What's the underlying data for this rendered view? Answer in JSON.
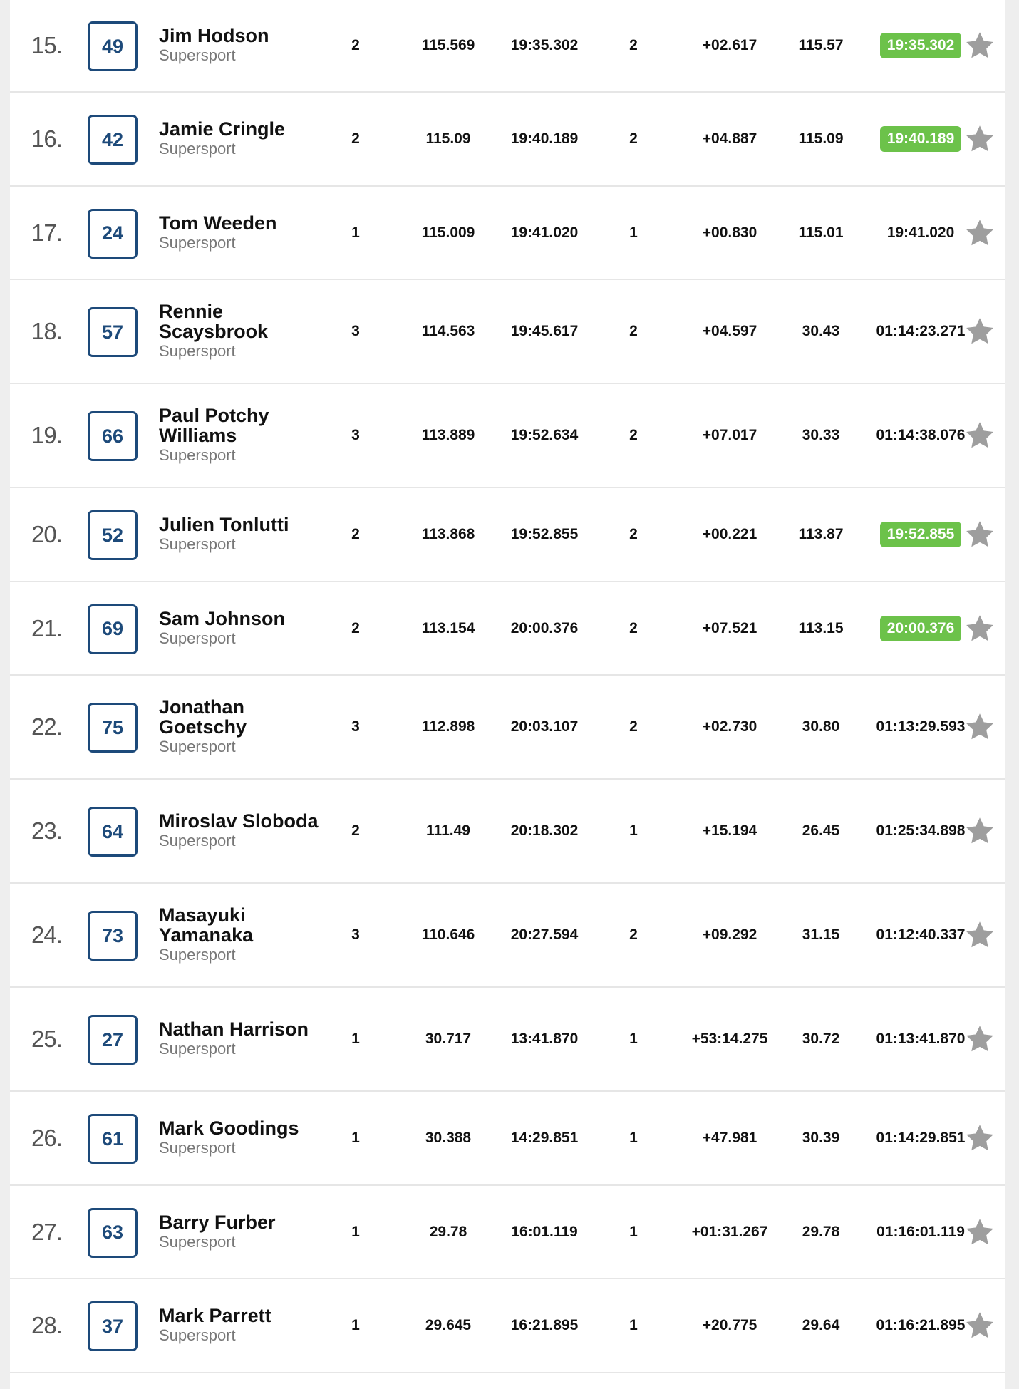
{
  "rows": [
    {
      "pos": "15.",
      "number": "49",
      "name": "Jim Hodson",
      "class": "Supersport",
      "laps": "2",
      "speed": "115.569",
      "time": "19:35.302",
      "best_lap": "2",
      "gap": "+02.617",
      "best_speed": "115.57",
      "best_time": "19:35.302",
      "highlight": true
    },
    {
      "pos": "16.",
      "number": "42",
      "name": "Jamie Cringle",
      "class": "Supersport",
      "laps": "2",
      "speed": "115.09",
      "time": "19:40.189",
      "best_lap": "2",
      "gap": "+04.887",
      "best_speed": "115.09",
      "best_time": "19:40.189",
      "highlight": true
    },
    {
      "pos": "17.",
      "number": "24",
      "name": "Tom Weeden",
      "class": "Supersport",
      "laps": "1",
      "speed": "115.009",
      "time": "19:41.020",
      "best_lap": "1",
      "gap": "+00.830",
      "best_speed": "115.01",
      "best_time": "19:41.020",
      "highlight": false
    },
    {
      "pos": "18.",
      "number": "57",
      "name": "Rennie Scaysbrook",
      "class": "Supersport",
      "laps": "3",
      "speed": "114.563",
      "time": "19:45.617",
      "best_lap": "2",
      "gap": "+04.597",
      "best_speed": "30.43",
      "best_time": "01:14:23.271",
      "highlight": false
    },
    {
      "pos": "19.",
      "number": "66",
      "name": "Paul Potchy Williams",
      "class": "Supersport",
      "laps": "3",
      "speed": "113.889",
      "time": "19:52.634",
      "best_lap": "2",
      "gap": "+07.017",
      "best_speed": "30.33",
      "best_time": "01:14:38.076",
      "highlight": false
    },
    {
      "pos": "20.",
      "number": "52",
      "name": "Julien Tonlutti",
      "class": "Supersport",
      "laps": "2",
      "speed": "113.868",
      "time": "19:52.855",
      "best_lap": "2",
      "gap": "+00.221",
      "best_speed": "113.87",
      "best_time": "19:52.855",
      "highlight": true
    },
    {
      "pos": "21.",
      "number": "69",
      "name": "Sam Johnson",
      "class": "Supersport",
      "laps": "2",
      "speed": "113.154",
      "time": "20:00.376",
      "best_lap": "2",
      "gap": "+07.521",
      "best_speed": "113.15",
      "best_time": "20:00.376",
      "highlight": true
    },
    {
      "pos": "22.",
      "number": "75",
      "name": "Jonathan Goetschy",
      "class": "Supersport",
      "laps": "3",
      "speed": "112.898",
      "time": "20:03.107",
      "best_lap": "2",
      "gap": "+02.730",
      "best_speed": "30.80",
      "best_time": "01:13:29.593",
      "highlight": false
    },
    {
      "pos": "23.",
      "number": "64",
      "name": "Miroslav Sloboda",
      "class": "Supersport",
      "laps": "2",
      "speed": "111.49",
      "time": "20:18.302",
      "best_lap": "1",
      "gap": "+15.194",
      "best_speed": "26.45",
      "best_time": "01:25:34.898",
      "highlight": false
    },
    {
      "pos": "24.",
      "number": "73",
      "name": "Masayuki Yamanaka",
      "class": "Supersport",
      "laps": "3",
      "speed": "110.646",
      "time": "20:27.594",
      "best_lap": "2",
      "gap": "+09.292",
      "best_speed": "31.15",
      "best_time": "01:12:40.337",
      "highlight": false
    },
    {
      "pos": "25.",
      "number": "27",
      "name": "Nathan Harrison",
      "class": "Supersport",
      "laps": "1",
      "speed": "30.717",
      "time": "13:41.870",
      "best_lap": "1",
      "gap": "+53:14.275",
      "best_speed": "30.72",
      "best_time": "01:13:41.870",
      "highlight": false
    },
    {
      "pos": "26.",
      "number": "61",
      "name": "Mark Goodings",
      "class": "Supersport",
      "laps": "1",
      "speed": "30.388",
      "time": "14:29.851",
      "best_lap": "1",
      "gap": "+47.981",
      "best_speed": "30.39",
      "best_time": "01:14:29.851",
      "highlight": false
    },
    {
      "pos": "27.",
      "number": "63",
      "name": "Barry Furber",
      "class": "Supersport",
      "laps": "1",
      "speed": "29.78",
      "time": "16:01.119",
      "best_lap": "1",
      "gap": "+01:31.267",
      "best_speed": "29.78",
      "best_time": "01:16:01.119",
      "highlight": false
    },
    {
      "pos": "28.",
      "number": "37",
      "name": "Mark Parrett",
      "class": "Supersport",
      "laps": "1",
      "speed": "29.645",
      "time": "16:21.895",
      "best_lap": "1",
      "gap": "+20.775",
      "best_speed": "29.64",
      "best_time": "01:16:21.895",
      "highlight": false
    }
  ],
  "colors": {
    "highlight": "#6cc24a",
    "number_border": "#1d4a7a",
    "star": "#9e9e9e"
  },
  "icons": {
    "favorite": "star-icon"
  }
}
